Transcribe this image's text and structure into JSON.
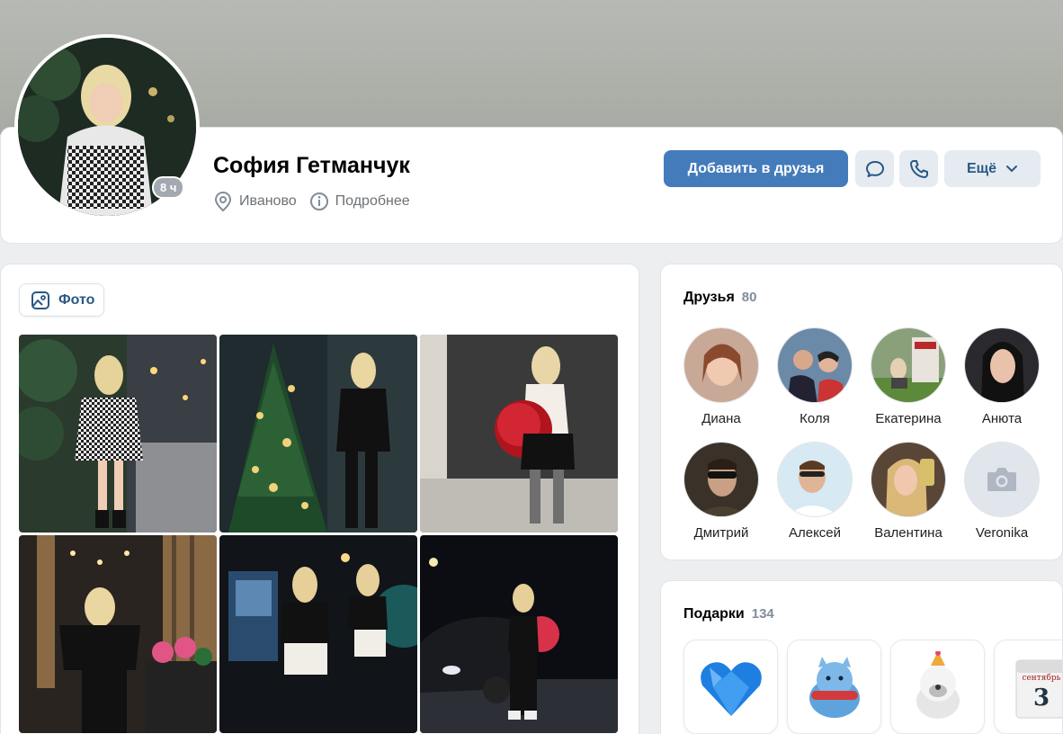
{
  "profile": {
    "name": "София Гетманчук",
    "city": "Иваново",
    "details_label": "Подробнее",
    "online_badge": "8 ч"
  },
  "actions": {
    "add_friend_label": "Добавить в друзья",
    "message_icon": "chat-bubble-icon",
    "call_icon": "phone-icon",
    "more_label": "Ещё"
  },
  "photos": {
    "tab_label": "Фото",
    "items": [
      {
        "desc": "photo-1"
      },
      {
        "desc": "photo-2"
      },
      {
        "desc": "photo-3"
      },
      {
        "desc": "photo-4"
      },
      {
        "desc": "photo-5"
      },
      {
        "desc": "photo-6"
      }
    ]
  },
  "friends": {
    "title": "Друзья",
    "count": "80",
    "items": [
      {
        "name": "Диана"
      },
      {
        "name": "Коля"
      },
      {
        "name": "Екатерина"
      },
      {
        "name": "Анюта"
      },
      {
        "name": "Дмитрий"
      },
      {
        "name": "Алексей"
      },
      {
        "name": "Валентина"
      },
      {
        "name": "Veronika"
      }
    ]
  },
  "gifts": {
    "title": "Подарки",
    "count": "134",
    "calendar_month": "сентябрь",
    "calendar_day": "3"
  },
  "colors": {
    "accent": "#447bba",
    "link": "#2a5885",
    "secondary_button": "#e5ebf1"
  }
}
